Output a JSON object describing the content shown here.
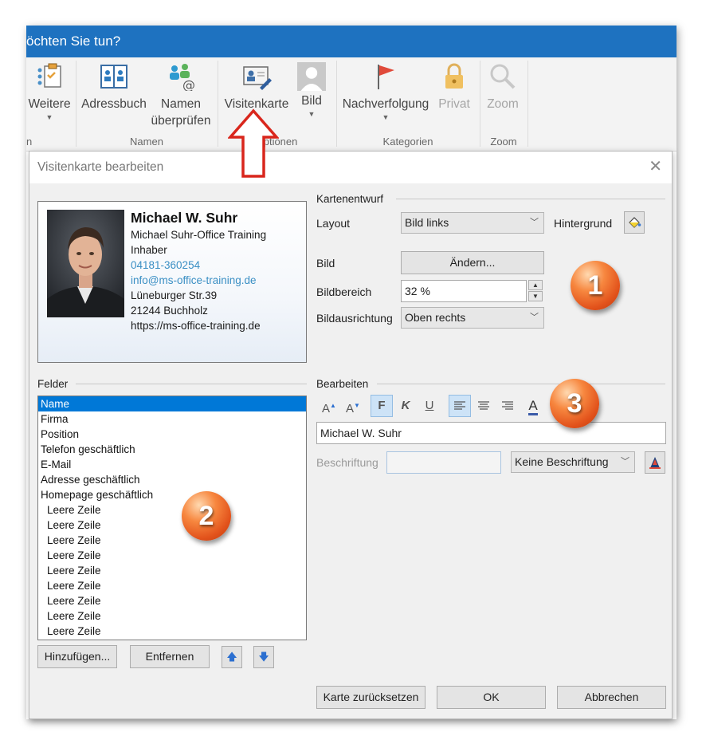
{
  "ribbon": {
    "tellme_text": "öchten Sie tun?",
    "buttons": {
      "weitere": "Weitere",
      "adressbuch": "Adressbuch",
      "namen_line1": "Namen",
      "namen_line2": "überprüfen",
      "visitenkarte": "Visitenkarte",
      "bild": "Bild",
      "nachverfolgung": "Nachverfolgung",
      "privat": "Privat",
      "zoom": "Zoom"
    },
    "groups": {
      "namen": "Namen",
      "optionen": "Optionen",
      "kategorien": "Kategorien",
      "zoom": "Zoom",
      "left_fragment": "n"
    }
  },
  "dialog": {
    "title": "Visitenkarte bearbeiten",
    "close_glyph": "✕",
    "card": {
      "name": "Michael W. Suhr",
      "company": "Michael Suhr-Office Training",
      "position": "Inhaber",
      "phone": "04181-360254",
      "email": "info@ms-office-training.de",
      "street": "Lüneburger Str.39",
      "city": "21244 Buchholz",
      "web": "https://ms-office-training.de"
    },
    "kartenentwurf": {
      "section": "Kartenentwurf",
      "layout_label": "Layout",
      "layout_value": "Bild links",
      "hintergrund_label": "Hintergrund",
      "bild_label": "Bild",
      "aendern_button": "Ändern...",
      "bildbereich_label": "Bildbereich",
      "bildbereich_value": "32 %",
      "bildausrichtung_label": "Bildausrichtung",
      "bildausrichtung_value": "Oben rechts"
    },
    "felder": {
      "section": "Felder",
      "items": [
        {
          "label": "Name",
          "selected": true
        },
        {
          "label": "Firma"
        },
        {
          "label": "Position"
        },
        {
          "label": "Telefon geschäftlich"
        },
        {
          "label": "E-Mail"
        },
        {
          "label": "Adresse geschäftlich"
        },
        {
          "label": "Homepage geschäftlich"
        },
        {
          "label": "Leere Zeile",
          "sub": true
        },
        {
          "label": "Leere Zeile",
          "sub": true
        },
        {
          "label": "Leere Zeile",
          "sub": true
        },
        {
          "label": "Leere Zeile",
          "sub": true
        },
        {
          "label": "Leere Zeile",
          "sub": true
        },
        {
          "label": "Leere Zeile",
          "sub": true
        },
        {
          "label": "Leere Zeile",
          "sub": true
        },
        {
          "label": "Leere Zeile",
          "sub": true
        },
        {
          "label": "Leere Zeile",
          "sub": true
        }
      ],
      "hinzufuegen_button": "Hinzufügen...",
      "entfernen_button": "Entfernen"
    },
    "bearbeiten": {
      "section": "Bearbeiten",
      "format_buttons": {
        "grow": "A",
        "shrink": "A",
        "bold": "F",
        "italic": "K",
        "underline": "U",
        "font_color": "A"
      },
      "text_value": "Michael W. Suhr",
      "beschriftung_label": "Beschriftung",
      "beschriftung_value": "",
      "beschriftung_combo": "Keine Beschriftung"
    },
    "footer": {
      "reset_button": "Karte zurücksetzen",
      "ok_button": "OK",
      "cancel_button": "Abbrechen"
    }
  },
  "callouts": [
    "1",
    "2",
    "3"
  ],
  "colors": {
    "title_bar_blue": "#1e72c0",
    "selection_blue": "#0078d7",
    "link_blue": "#3a8fc4",
    "callout_orange": "#e2521b",
    "arrow_red": "#d9261c"
  }
}
